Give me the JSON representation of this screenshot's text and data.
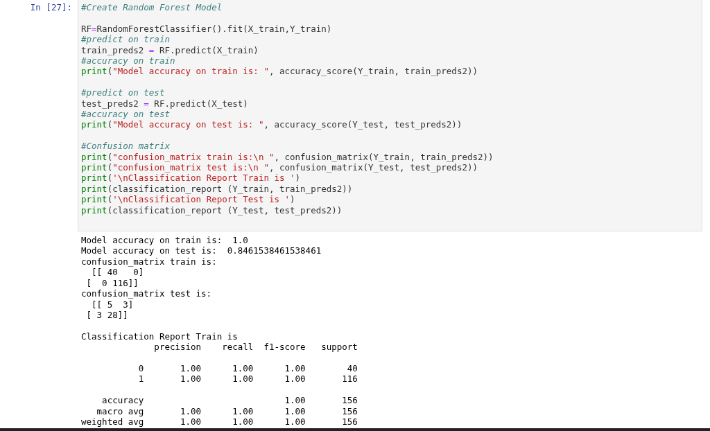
{
  "cell": {
    "prompt": "In [27]:",
    "code_blocks": [
      {
        "lines": [
          [
            {
              "kind": "comment",
              "text": "#Create Random Forest Model"
            }
          ]
        ]
      },
      {
        "lines": [
          [
            {
              "kind": "name",
              "text": "RF"
            },
            {
              "kind": "op",
              "text": "="
            },
            {
              "kind": "name",
              "text": "RandomForestClassifier().fit(X_train,Y_train)"
            }
          ],
          [
            {
              "kind": "comment",
              "text": "#predict on train"
            }
          ],
          [
            {
              "kind": "name",
              "text": "train_preds2 "
            },
            {
              "kind": "op",
              "text": "="
            },
            {
              "kind": "name",
              "text": " RF.predict(X_train)"
            }
          ],
          [
            {
              "kind": "comment",
              "text": "#accuracy on train"
            }
          ],
          [
            {
              "kind": "builtin",
              "text": "print"
            },
            {
              "kind": "name",
              "text": "("
            },
            {
              "kind": "string",
              "text": "\"Model accuracy on train is: \""
            },
            {
              "kind": "name",
              "text": ", accuracy_score(Y_train, train_preds2))"
            }
          ]
        ]
      },
      {
        "lines": [
          [
            {
              "kind": "comment",
              "text": "#predict on test"
            }
          ],
          [
            {
              "kind": "name",
              "text": "test_preds2 "
            },
            {
              "kind": "op",
              "text": "="
            },
            {
              "kind": "name",
              "text": " RF.predict(X_test)"
            }
          ],
          [
            {
              "kind": "comment",
              "text": "#accuracy on test"
            }
          ],
          [
            {
              "kind": "builtin",
              "text": "print"
            },
            {
              "kind": "name",
              "text": "("
            },
            {
              "kind": "string",
              "text": "\"Model accuracy on test is: \""
            },
            {
              "kind": "name",
              "text": ", accuracy_score(Y_test, test_preds2))"
            }
          ]
        ]
      },
      {
        "lines": [
          [
            {
              "kind": "comment",
              "text": "#Confusion matrix"
            }
          ],
          [
            {
              "kind": "builtin",
              "text": "print"
            },
            {
              "kind": "name",
              "text": "("
            },
            {
              "kind": "string",
              "text": "\"confusion_matrix train is:\\n \""
            },
            {
              "kind": "name",
              "text": ", confusion_matrix(Y_train, train_preds2))"
            }
          ],
          [
            {
              "kind": "builtin",
              "text": "print"
            },
            {
              "kind": "name",
              "text": "("
            },
            {
              "kind": "string",
              "text": "\"confusion_matrix test is:\\n \""
            },
            {
              "kind": "name",
              "text": ", confusion_matrix(Y_test, test_preds2))"
            }
          ],
          [
            {
              "kind": "builtin",
              "text": "print"
            },
            {
              "kind": "name",
              "text": "("
            },
            {
              "kind": "string",
              "text": "'\\nClassification Report Train is '"
            },
            {
              "kind": "name",
              "text": ")"
            }
          ],
          [
            {
              "kind": "builtin",
              "text": "print"
            },
            {
              "kind": "name",
              "text": "(classification_report (Y_train, train_preds2))"
            }
          ],
          [
            {
              "kind": "builtin",
              "text": "print"
            },
            {
              "kind": "name",
              "text": "("
            },
            {
              "kind": "string",
              "text": "'\\nClassification Report Test is '"
            },
            {
              "kind": "name",
              "text": ")"
            }
          ],
          [
            {
              "kind": "builtin",
              "text": "print"
            },
            {
              "kind": "name",
              "text": "(classification_report (Y_test, test_preds2))"
            }
          ]
        ]
      }
    ],
    "output_blocks": [
      {
        "lines": [
          "Model accuracy on train is:  1.0",
          "Model accuracy on test is:  0.8461538461538461",
          "confusion_matrix train is:",
          "  [[ 40   0]",
          " [  0 116]]",
          "confusion_matrix test is:",
          "  [[ 5  3]",
          " [ 3 28]]"
        ]
      },
      {
        "lines": [
          "Classification Report Train is",
          "              precision    recall  f1-score   support"
        ]
      },
      {
        "lines": [
          "           0       1.00      1.00      1.00        40",
          "           1       1.00      1.00      1.00       116"
        ]
      },
      {
        "lines": [
          "    accuracy                           1.00       156",
          "   macro avg       1.00      1.00      1.00       156",
          "weighted avg       1.00      1.00      1.00       156"
        ]
      }
    ]
  }
}
